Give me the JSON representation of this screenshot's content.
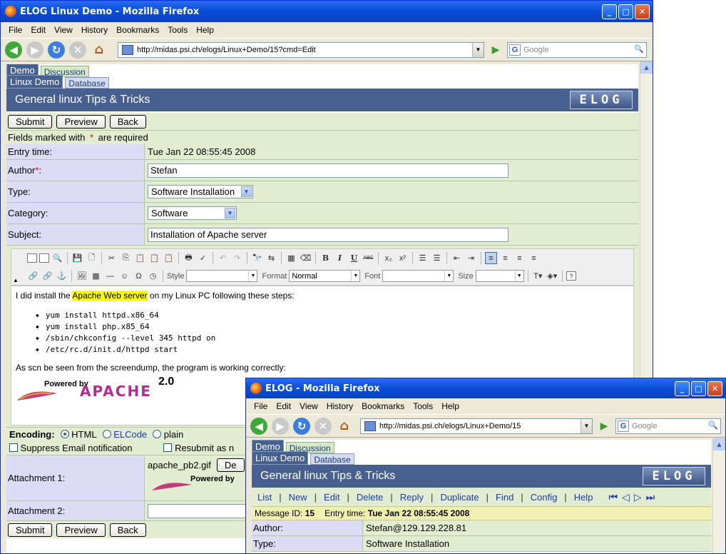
{
  "main_window": {
    "title": "ELOG Linux Demo - Mozilla Firefox",
    "menu": [
      "File",
      "Edit",
      "View",
      "History",
      "Bookmarks",
      "Tools",
      "Help"
    ],
    "url": "http://midas.psi.ch/elogs/Linux+Demo/15?cmd=Edit",
    "search_placeholder": "Google",
    "tabs_top": [
      "Demo",
      "Discussion"
    ],
    "tabs_sub": [
      "Linux Demo",
      "Database"
    ],
    "header_title": "General linux Tips & Tricks",
    "logo_text": "ELOG",
    "buttons": {
      "submit": "Submit",
      "preview": "Preview",
      "back": "Back"
    },
    "required_note_pre": "Fields marked with ",
    "required_star": "*",
    "required_note_post": " are required",
    "fields": {
      "entry_time_label": "Entry time:",
      "entry_time_value": "Tue Jan 22 08:55:45 2008",
      "author_label": "Author",
      "author_star": "*",
      "author_colon": ":",
      "author_value": "Stefan",
      "type_label": "Type:",
      "type_value": "Software Installation",
      "category_label": "Category:",
      "category_value": "Software",
      "subject_label": "Subject:",
      "subject_value": "Installation of Apache server"
    },
    "editor": {
      "style_label": "Style",
      "format_label": "Format",
      "format_value": "Normal",
      "font_label": "Font",
      "size_label": "Size",
      "intro_pre": "I did install the ",
      "intro_hl": "Apache Web server",
      "intro_post": " on my Linux PC following these steps:",
      "steps": [
        "yum install httpd.x86_64",
        "yum install php.x85_64",
        "/sbin/chkconfig --level 345 httpd on",
        "/etc/rc.d/init.d/httpd start"
      ],
      "outro": "As scn be seen from the screendump, the program is working correctly:",
      "apache_powered": "Powered by",
      "apache_name": "APACHE",
      "apache_version": "2.0"
    },
    "encoding": {
      "label": "Encoding:",
      "options": [
        "HTML",
        "ELCode",
        "plain"
      ],
      "suppress": "Suppress Email notification",
      "resubmit": "Resubmit as n"
    },
    "attachments": {
      "a1_label": "Attachment 1:",
      "a1_file": "apache_pb2.gif",
      "a1_btn": "De",
      "a2_label": "Attachment 2:"
    }
  },
  "second_window": {
    "title": "ELOG - Mozilla Firefox",
    "menu": [
      "File",
      "Edit",
      "View",
      "History",
      "Bookmarks",
      "Tools",
      "Help"
    ],
    "url": "http://midas.psi.ch/elogs/Linux+Demo/15",
    "search_placeholder": "Google",
    "tabs_top": [
      "Demo",
      "Discussion"
    ],
    "tabs_sub": [
      "Linux Demo",
      "Database"
    ],
    "header_title": "General linux Tips & Tricks",
    "logo_text": "ELOG",
    "nav_links": [
      "List",
      "New",
      "Edit",
      "Delete",
      "Reply",
      "Duplicate",
      "Find",
      "Config",
      "Help"
    ],
    "message_id_label": "Message ID:",
    "message_id": "15",
    "entry_time_label": "Entry time:",
    "entry_time": "Tue Jan 22 08:55:45 2008",
    "author_label": "Author:",
    "author_value": "Stefan@129.129.228.81",
    "type_label": "Type:",
    "type_value": "Software Installation"
  }
}
